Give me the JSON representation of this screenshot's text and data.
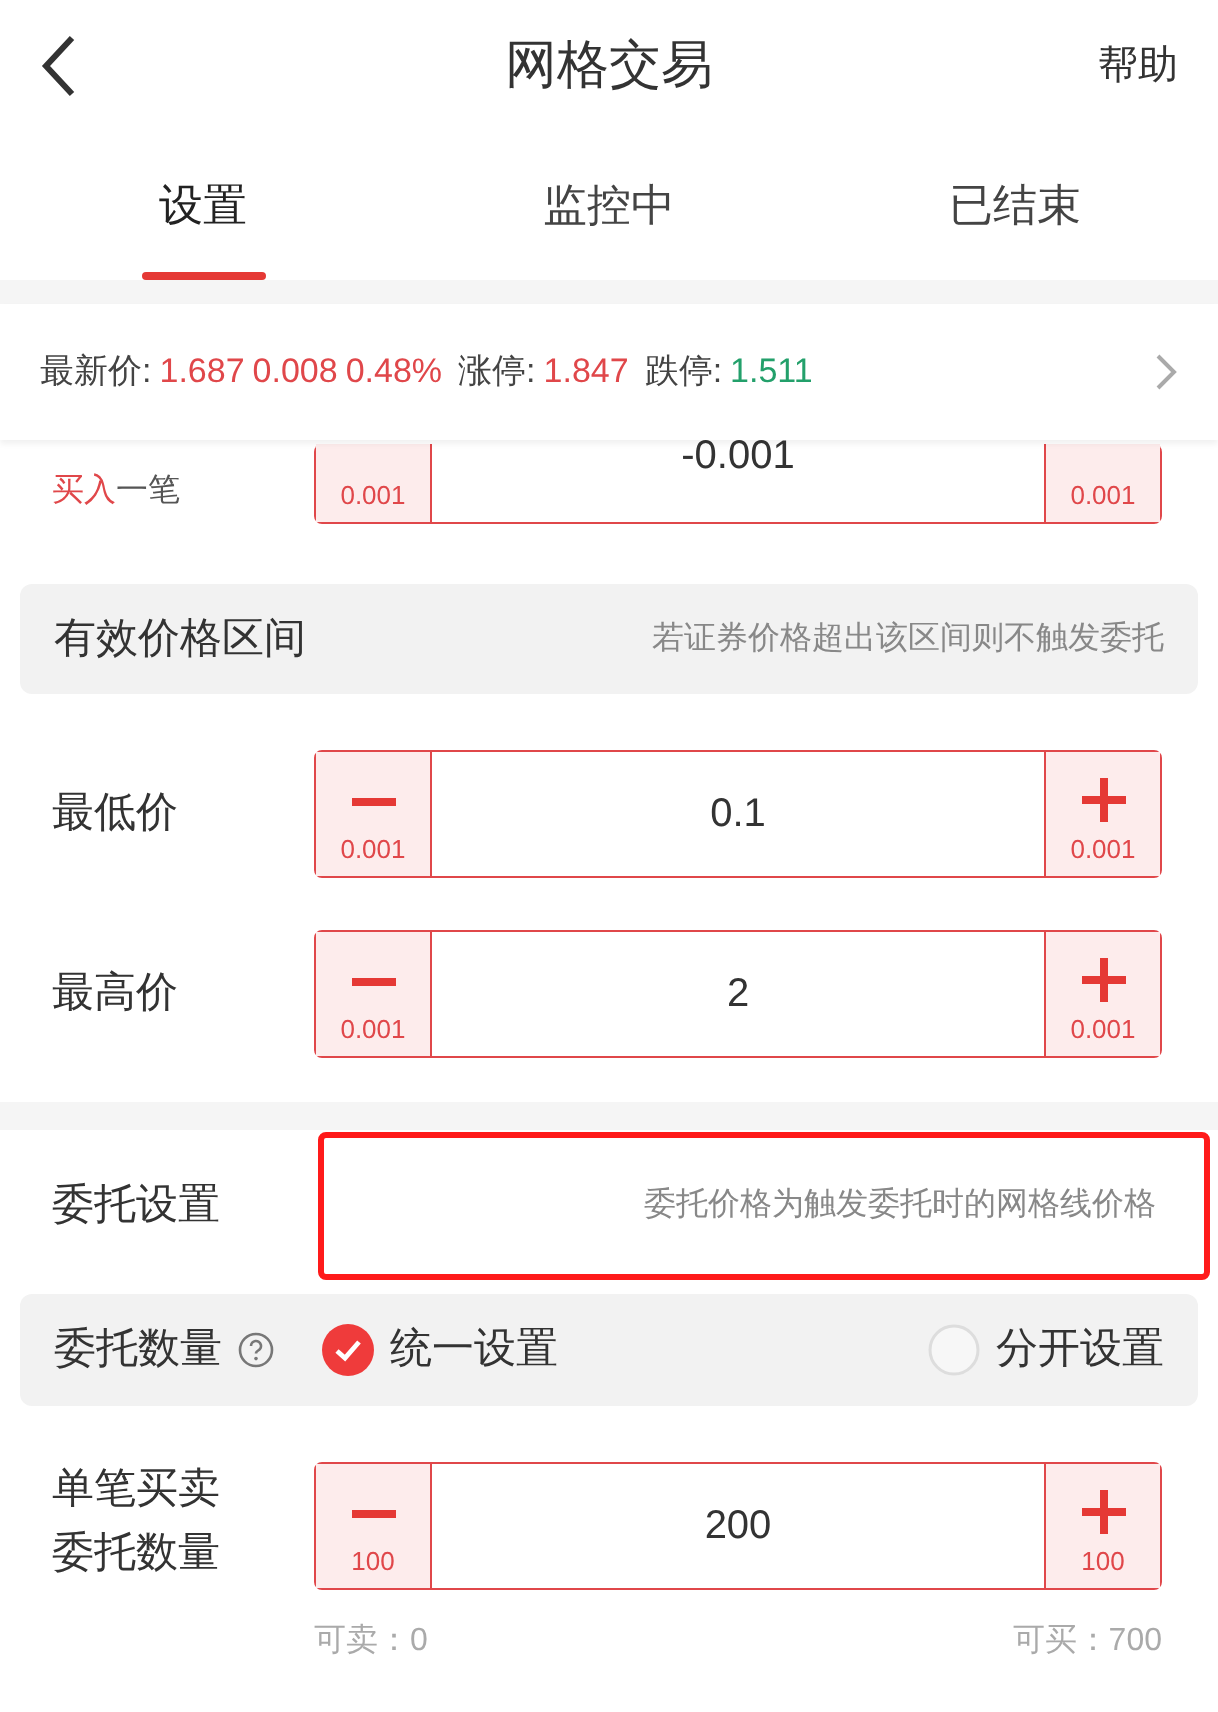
{
  "header": {
    "title": "网格交易",
    "help": "帮助"
  },
  "tabs": [
    {
      "label": "设置",
      "selected": true
    },
    {
      "label": "监控中",
      "selected": false
    },
    {
      "label": "已结束",
      "selected": false
    }
  ],
  "quote": {
    "items": [
      {
        "label": "最新价:",
        "values": [
          {
            "text": "1.687",
            "color": "#e0474a"
          },
          {
            "text": "0.008",
            "color": "#e0474a"
          },
          {
            "text": "0.48%",
            "color": "#e0474a"
          }
        ]
      },
      {
        "label": "涨停:",
        "values": [
          {
            "text": "1.847",
            "color": "#e0474a"
          }
        ]
      },
      {
        "label": "跌停:",
        "values": [
          {
            "text": "1.511",
            "color": "#23a06b"
          }
        ]
      }
    ]
  },
  "partial_row": {
    "action": "买入",
    "suffix": "一笔",
    "value": "-0.001",
    "minus_step": "0.001",
    "plus_step": "0.001"
  },
  "price_range": {
    "title": "有效价格区间",
    "hint": "若证券价格超出该区间则不触发委托",
    "rows": [
      {
        "label": "最低价",
        "value": "0.1",
        "minus_step": "0.001",
        "plus_step": "0.001"
      },
      {
        "label": "最高价",
        "value": "2",
        "minus_step": "0.001",
        "plus_step": "0.001"
      }
    ]
  },
  "order_settings": {
    "title": "委托设置",
    "hint": "委托价格为触发委托时的网格线价格",
    "highlighted": true
  },
  "quantity": {
    "title": "委托数量",
    "options": [
      {
        "label": "统一设置",
        "selected": true
      },
      {
        "label": "分开设置",
        "selected": false
      }
    ],
    "label_lines": [
      "单笔买卖",
      "委托数量"
    ],
    "value": "200",
    "minus_step": "100",
    "plus_step": "100",
    "sellable": "可卖：0",
    "buyable": "可买：700"
  }
}
